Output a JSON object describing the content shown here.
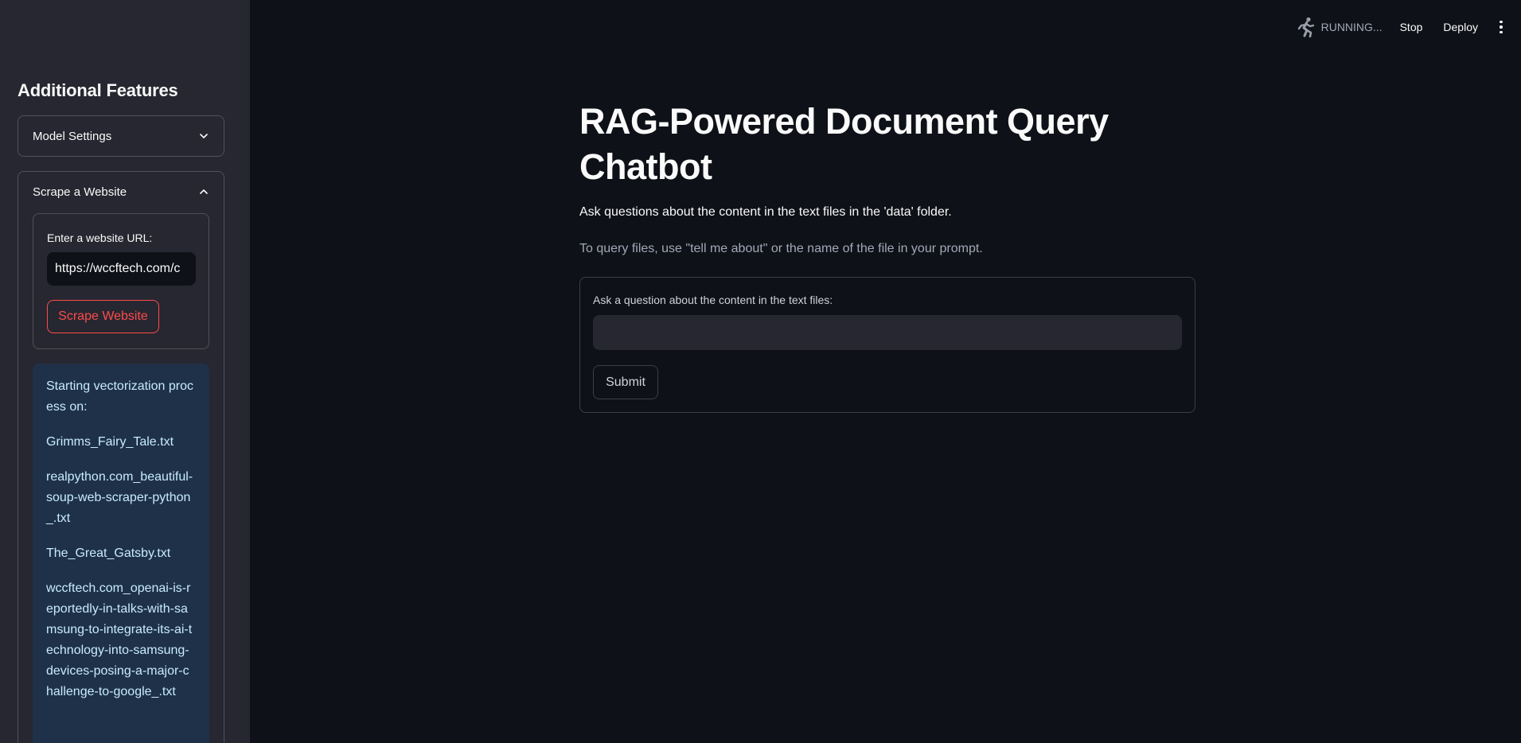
{
  "sidebar": {
    "title": "Additional Features",
    "model_expander": {
      "label": "Model Settings",
      "icon": "chevron-down-icon"
    },
    "scrape_expander": {
      "label": "Scrape a Website",
      "icon": "chevron-up-icon",
      "url_label": "Enter a website URL:",
      "url_value": "https://wccftech.com/c",
      "button_label": "Scrape Website"
    },
    "info": {
      "lines": [
        "Starting vectorization process on:",
        "Grimms_Fairy_Tale.txt",
        "realpython.com_beautiful-soup-web-scraper-python_.txt",
        "The_Great_Gatsby.txt",
        "wccftech.com_openai-is-reportedly-in-talks-with-samsung-to-integrate-its-ai-technology-into-samsung-devices-posing-a-major-challenge-to-google_.txt"
      ]
    }
  },
  "header": {
    "status": "RUNNING...",
    "status_icon": "running-man-icon",
    "stop_label": "Stop",
    "deploy_label": "Deploy",
    "menu_icon": "kebab-menu-icon"
  },
  "main": {
    "title": "RAG-Powered Document Query Chatbot",
    "description": "Ask questions about the content in the text files in the 'data' folder.",
    "hint": "To query files, use \"tell me about\" or the name of the file in your prompt.",
    "question_label": "Ask a question about the content in the text files:",
    "question_value": "",
    "submit_label": "Submit"
  },
  "colors": {
    "background": "#0e1117",
    "sidebar": "#262730",
    "accent": "#ff4b4b",
    "info_bg": "#1f3148",
    "info_text": "#c7ebff"
  }
}
